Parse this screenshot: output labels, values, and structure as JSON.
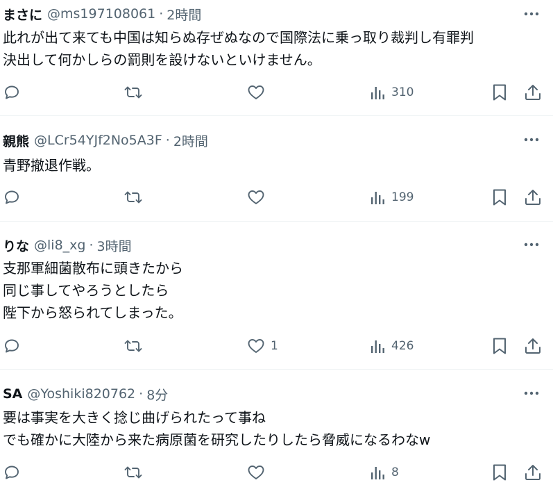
{
  "tweets": [
    {
      "name": "まさに",
      "handle": "@ms197108061",
      "separator": "·",
      "time": "2時間",
      "lines": [
        "此れが出て来ても中国は知らぬ存ぜぬなので国際法に乗っ取り裁判し有罪判",
        "決出して何かしらの罰則を設けないといけません。"
      ],
      "likes": "",
      "views": "310"
    },
    {
      "name": "親熊",
      "handle": "@LCr54YJf2No5A3F",
      "separator": "·",
      "time": "2時間",
      "lines": [
        "青野撤退作戦。"
      ],
      "likes": "",
      "views": "199"
    },
    {
      "name": "りな",
      "handle": "@li8_xg",
      "separator": "·",
      "time": "3時間",
      "lines": [
        "支那軍細菌散布に頭きたから",
        "同じ事してやろうとしたら",
        "陛下から怒られてしまった。"
      ],
      "likes": "1",
      "views": "426"
    },
    {
      "name": "SA",
      "handle": "@Yoshiki820762",
      "separator": "·",
      "time": "8分",
      "lines": [
        "要は事実を大きく捻じ曲げられたって事ね",
        "でも確かに大陸から来た病原菌を研究したりしたら脅威になるわなw"
      ],
      "likes": "",
      "views": "8"
    }
  ],
  "icons": {
    "more": "more-horizontal-icon",
    "reply": "reply-bubble-icon",
    "retweet": "retweet-icon",
    "like": "heart-icon",
    "views": "views-bar-chart-icon",
    "bookmark": "bookmark-icon",
    "share": "share-upload-icon"
  },
  "colors": {
    "text": "#0f1419",
    "secondary": "#536471",
    "divider": "#eff3f4",
    "background": "#ffffff"
  }
}
